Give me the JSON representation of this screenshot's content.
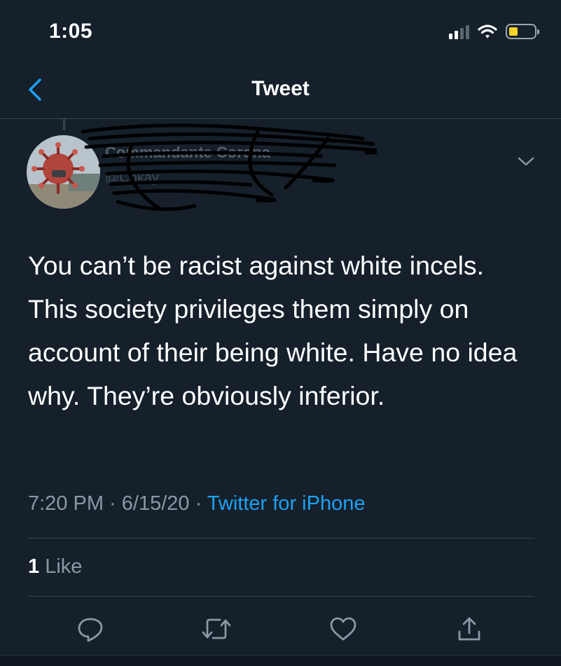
{
  "status_bar": {
    "time": "1:05"
  },
  "nav": {
    "title": "Tweet"
  },
  "author": {
    "name": "Commandante Corona",
    "handle": "@Cokay"
  },
  "tweet": {
    "text": "You can’t be racist against white incels. This society privileges them simply on account of their being white. Have no idea why. They’re obviously inferior.",
    "time": "7:20 PM",
    "separator": " · ",
    "date": "6/15/20",
    "source": "Twitter for iPhone"
  },
  "stats": {
    "likes_count": "1",
    "likes_label": "Like"
  },
  "icons": {
    "back": "chevron-left-icon",
    "more": "chevron-down-icon",
    "reply": "speech-bubble-icon",
    "retweet": "retweet-arrows-icon",
    "like": "heart-icon",
    "share": "share-upload-icon"
  },
  "colors": {
    "background": "#15202b",
    "accent": "#1da1f2",
    "secondary_text": "#8899a6",
    "divider": "#38444d"
  }
}
